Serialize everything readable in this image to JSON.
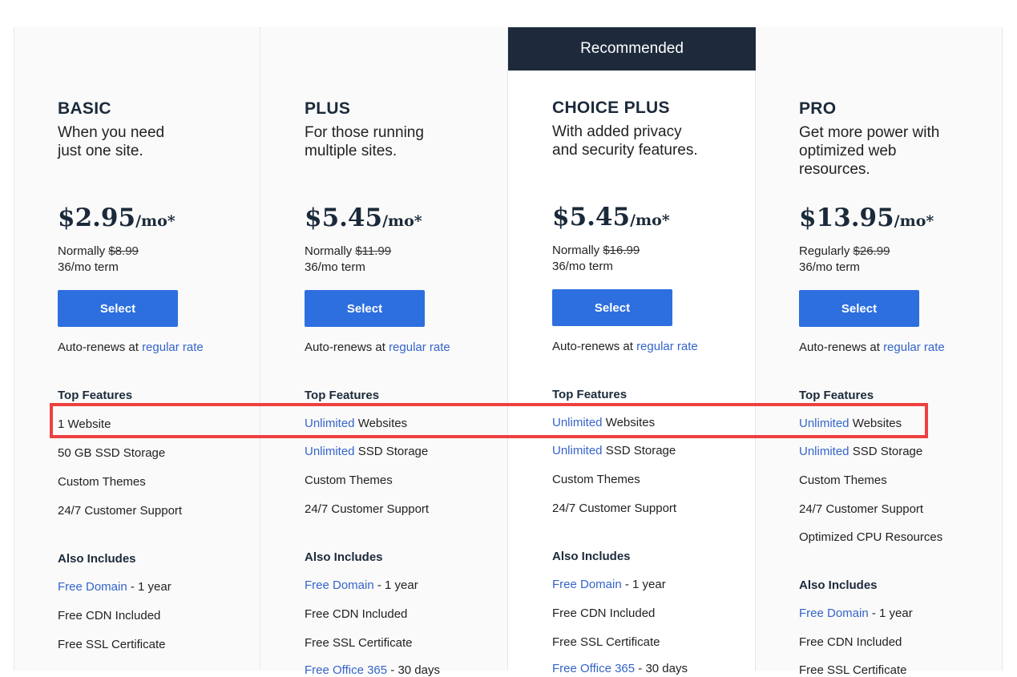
{
  "recommended_label": "Recommended",
  "auto_renew_text": "Auto-renews at ",
  "auto_renew_link": "regular rate",
  "select_label": "Select",
  "top_features_title": "Top Features",
  "also_includes_title": "Also Includes",
  "plans": [
    {
      "name": "BASIC",
      "desc_line1": "When you need",
      "desc_line2": "just one site.",
      "desc_line3": "",
      "price": "$2.95",
      "per": "/mo*",
      "normal_label": "Normally ",
      "normal_price": "$8.99",
      "term": "36/mo term",
      "features": [
        {
          "link": "",
          "text": "1 Website"
        },
        {
          "link": "",
          "text": "50 GB SSD Storage"
        },
        {
          "link": "",
          "text": "Custom Themes"
        },
        {
          "link": "",
          "text": "24/7 Customer Support"
        }
      ],
      "extra_feature": "",
      "includes": [
        {
          "link": "Free Domain",
          "text": " - 1 year"
        },
        {
          "link": "",
          "text": "Free CDN Included"
        },
        {
          "link": "",
          "text": "Free SSL Certificate"
        }
      ]
    },
    {
      "name": "PLUS",
      "desc_line1": "For those running",
      "desc_line2": "multiple sites.",
      "desc_line3": "",
      "price": "$5.45",
      "per": "/mo*",
      "normal_label": "Normally ",
      "normal_price": "$11.99",
      "term": "36/mo term",
      "features": [
        {
          "link": "Unlimited",
          "text": " Websites"
        },
        {
          "link": "Unlimited",
          "text": " SSD Storage"
        },
        {
          "link": "",
          "text": "Custom Themes"
        },
        {
          "link": "",
          "text": "24/7 Customer Support"
        }
      ],
      "extra_feature": "",
      "includes": [
        {
          "link": "Free Domain",
          "text": " - 1 year"
        },
        {
          "link": "",
          "text": "Free CDN Included"
        },
        {
          "link": "",
          "text": "Free SSL Certificate"
        },
        {
          "link": "Free Office 365",
          "text": " - 30 days"
        }
      ]
    },
    {
      "name": "CHOICE PLUS",
      "desc_line1": "With added privacy",
      "desc_line2": "and security features.",
      "desc_line3": "",
      "price": "$5.45",
      "per": "/mo*",
      "normal_label": "Normally ",
      "normal_price": "$16.99",
      "term": "36/mo term",
      "features": [
        {
          "link": "Unlimited",
          "text": " Websites"
        },
        {
          "link": "Unlimited",
          "text": " SSD Storage"
        },
        {
          "link": "",
          "text": "Custom Themes"
        },
        {
          "link": "",
          "text": "24/7 Customer Support"
        }
      ],
      "extra_feature": "",
      "includes": [
        {
          "link": "Free Domain",
          "text": " - 1 year"
        },
        {
          "link": "",
          "text": "Free CDN Included"
        },
        {
          "link": "",
          "text": "Free SSL Certificate"
        },
        {
          "link": "Free Office 365",
          "text": " - 30 days"
        }
      ]
    },
    {
      "name": "PRO",
      "desc_line1": "Get more power with",
      "desc_line2": "optimized web",
      "desc_line3": "resources.",
      "price": "$13.95",
      "per": "/mo*",
      "normal_label": "Regularly ",
      "normal_price": "$26.99",
      "term": "36/mo term",
      "features": [
        {
          "link": "Unlimited",
          "text": " Websites"
        },
        {
          "link": "Unlimited",
          "text": " SSD Storage"
        },
        {
          "link": "",
          "text": "Custom Themes"
        },
        {
          "link": "",
          "text": "24/7 Customer Support"
        }
      ],
      "extra_feature": "Optimized CPU Resources",
      "includes": [
        {
          "link": "Free Domain",
          "text": " - 1 year"
        },
        {
          "link": "",
          "text": "Free CDN Included"
        },
        {
          "link": "",
          "text": "Free SSL Certificate"
        }
      ]
    }
  ]
}
